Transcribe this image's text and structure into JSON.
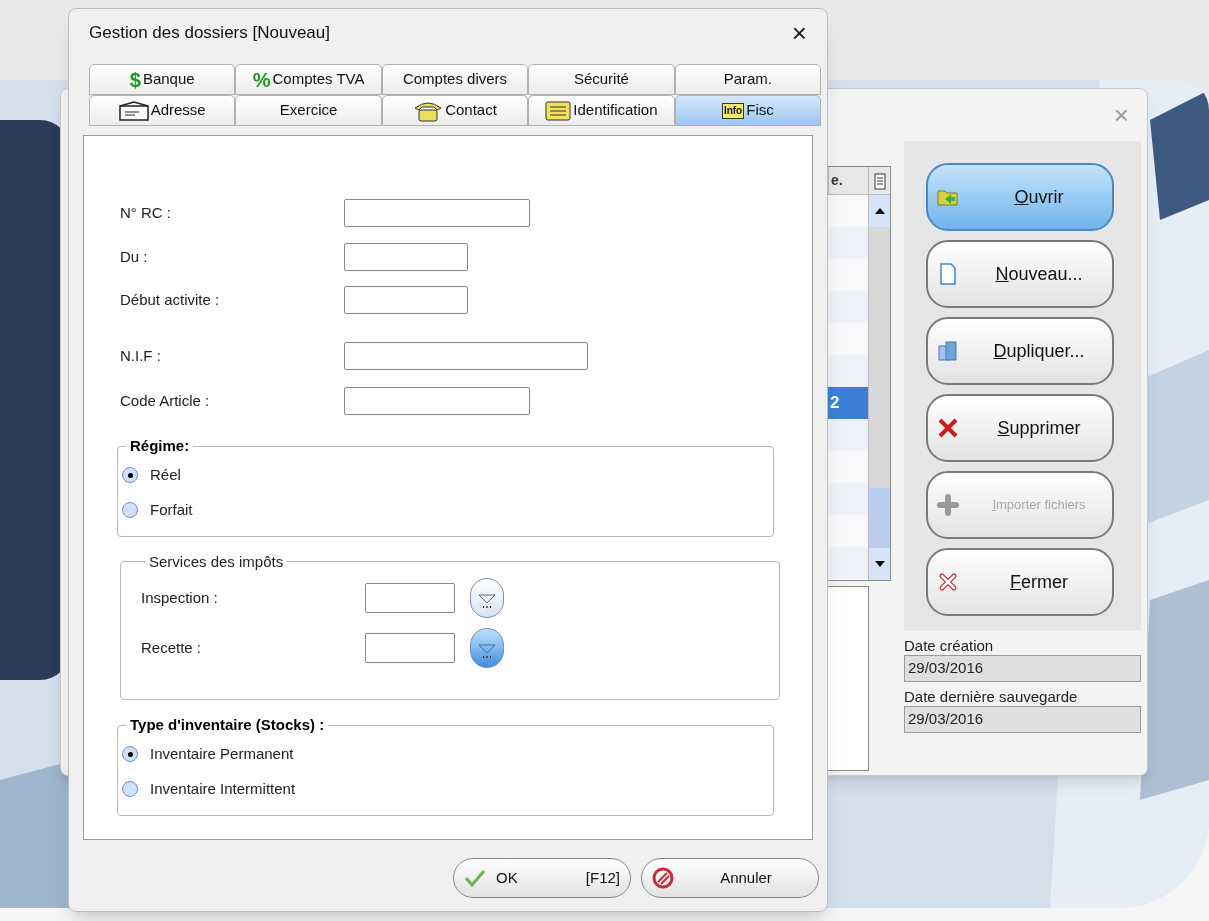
{
  "back_window": {
    "close": "×",
    "list": {
      "header": "e.",
      "rows": [
        {
          "selected": false
        },
        {
          "selected": false
        },
        {
          "selected": false
        },
        {
          "selected": false
        },
        {
          "selected": false
        },
        {
          "selected": false
        },
        {
          "selected": true,
          "value": "2"
        },
        {
          "selected": false
        },
        {
          "selected": false
        },
        {
          "selected": false
        },
        {
          "selected": false
        },
        {
          "selected": false
        }
      ]
    },
    "buttons": [
      {
        "kind": "open",
        "label": "Ouvrir",
        "default": true,
        "disabled": false
      },
      {
        "kind": "new",
        "label": "Nouveau...",
        "default": false,
        "disabled": false
      },
      {
        "kind": "duplicate",
        "label": "Dupliquer...",
        "default": false,
        "disabled": false
      },
      {
        "kind": "delete",
        "label": "Supprimer",
        "default": false,
        "disabled": false
      },
      {
        "kind": "import",
        "label": "Importer fichiers",
        "default": false,
        "disabled": true
      },
      {
        "kind": "close",
        "label": "Fermer",
        "default": false,
        "disabled": false
      }
    ],
    "dates": [
      {
        "label": "Date création",
        "value": "29/03/2016"
      },
      {
        "label": "Date dernière sauvegarde",
        "value": "29/03/2016"
      }
    ]
  },
  "dialog": {
    "title": "Gestion des dossiers [Nouveau]",
    "close": "×",
    "tab_rows": [
      [
        {
          "kind": "glyph",
          "glyph": "$",
          "label": "Banque",
          "selected": false
        },
        {
          "kind": "glyph",
          "glyph": "%",
          "label": "Comptes TVA",
          "selected": false
        },
        {
          "kind": "plain",
          "label": "Comptes divers",
          "selected": false
        },
        {
          "kind": "plain",
          "label": "Sécurité",
          "selected": false
        },
        {
          "kind": "plain",
          "label": "Param.",
          "selected": false
        }
      ],
      [
        {
          "kind": "envelope",
          "label": "Adresse",
          "selected": false
        },
        {
          "kind": "plain",
          "label": "Exercice",
          "selected": false
        },
        {
          "kind": "phone",
          "label": "Contact",
          "selected": false
        },
        {
          "kind": "folder",
          "label": "Identification",
          "selected": false
        },
        {
          "kind": "badge",
          "glyph": "Info",
          "label": "Fisc",
          "selected": true
        }
      ]
    ],
    "fields": [
      {
        "label": "N° RC :"
      },
      {
        "label": "Du :"
      },
      {
        "label": "Début activite :"
      },
      {
        "label": "N.I.F :"
      },
      {
        "label": "Code Article :"
      }
    ],
    "groups": [
      {
        "kind": "radio",
        "title": "Régime:",
        "options": [
          {
            "label": "Réel",
            "selected": true
          },
          {
            "label": "Forfait",
            "selected": false
          }
        ]
      },
      {
        "kind": "lookup",
        "title": "Services des impôts",
        "fields": [
          {
            "label": "Inspection :",
            "active": false
          },
          {
            "label": "Recette :",
            "active": true
          }
        ]
      },
      {
        "kind": "radio",
        "title": "Type d'inventaire (Stocks) :",
        "options": [
          {
            "label": "Inventaire Permanent",
            "selected": true
          },
          {
            "label": "Inventaire Intermittent",
            "selected": false
          }
        ]
      }
    ],
    "buttons": [
      {
        "kind": "ok",
        "label": "OK",
        "shortcut": "[F12]"
      },
      {
        "kind": "cancel",
        "label": "Annuler"
      }
    ]
  }
}
